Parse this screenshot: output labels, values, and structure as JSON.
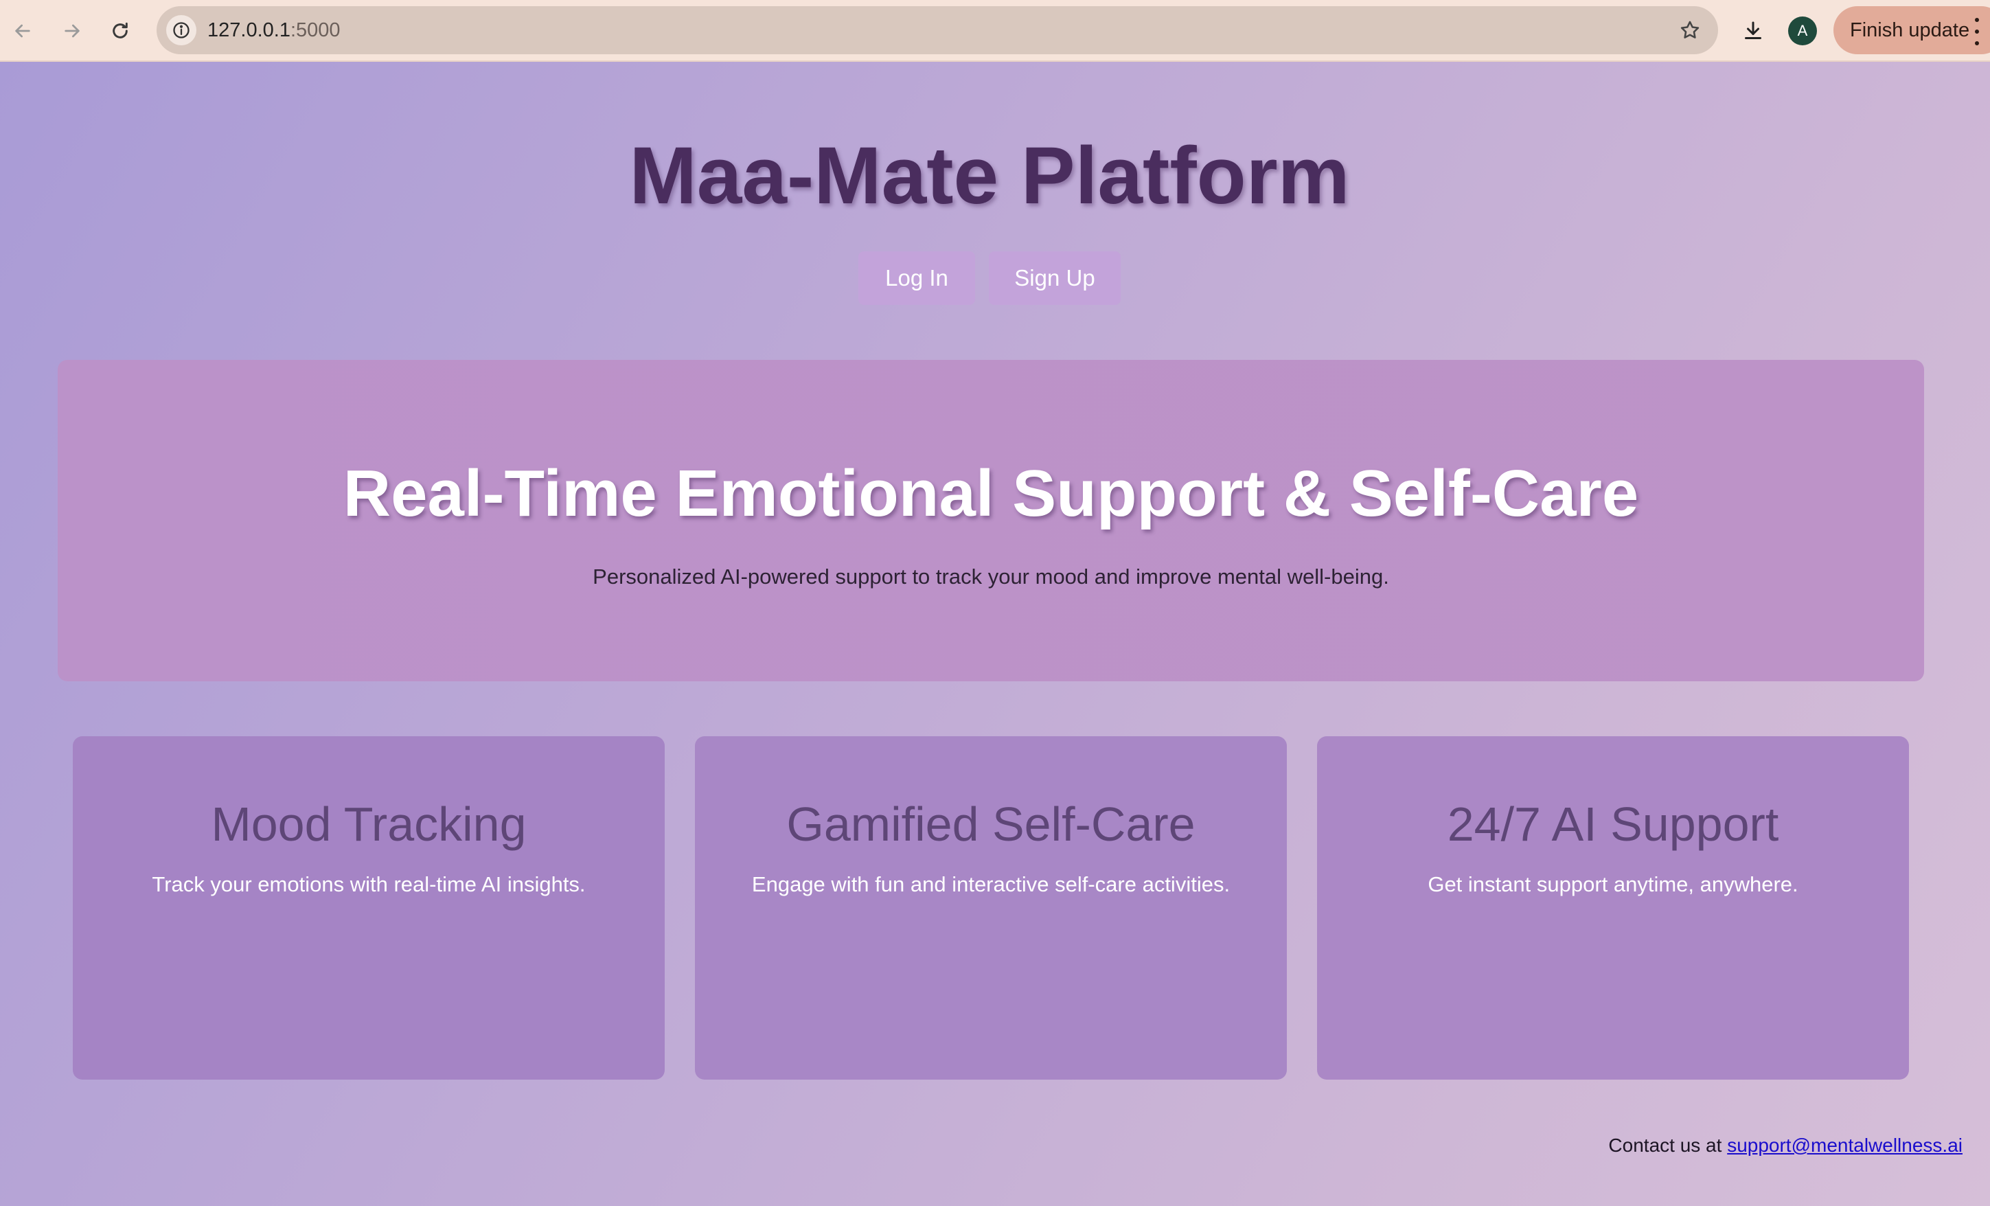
{
  "browser": {
    "url_host": "127.0.0.1",
    "url_port": ":5000",
    "profile_initial": "A",
    "finish_update_label": "Finish update",
    "icons": {
      "back": "arrow-left-icon",
      "forward": "arrow-right-icon",
      "reload": "reload-icon",
      "site_info": "info-icon",
      "bookmark": "star-icon",
      "download": "download-icon",
      "menu": "kebab-menu-icon"
    }
  },
  "header": {
    "title": "Maa-Mate Platform",
    "login_label": "Log In",
    "signup_label": "Sign Up"
  },
  "hero": {
    "title": "Real-Time Emotional Support & Self-Care",
    "subtitle": "Personalized AI-powered support to track your mood and improve mental well-being."
  },
  "features": [
    {
      "title": "Mood Tracking",
      "description": "Track your emotions with real-time AI insights."
    },
    {
      "title": "Gamified Self-Care",
      "description": "Engage with fun and interactive self-care activities."
    },
    {
      "title": "24/7 AI Support",
      "description": "Get instant support anytime, anywhere."
    }
  ],
  "footer": {
    "contact_prefix": "Contact us at ",
    "contact_email": "support@mentalwellness.ai"
  },
  "colors": {
    "title_color": "#4a2d5e",
    "button_bg": "#c3a3da",
    "hero_bg": "#bb92c9",
    "card_bg": "#a887c6",
    "card_title_color": "#5e4677",
    "link_color": "#1a0dcc"
  }
}
